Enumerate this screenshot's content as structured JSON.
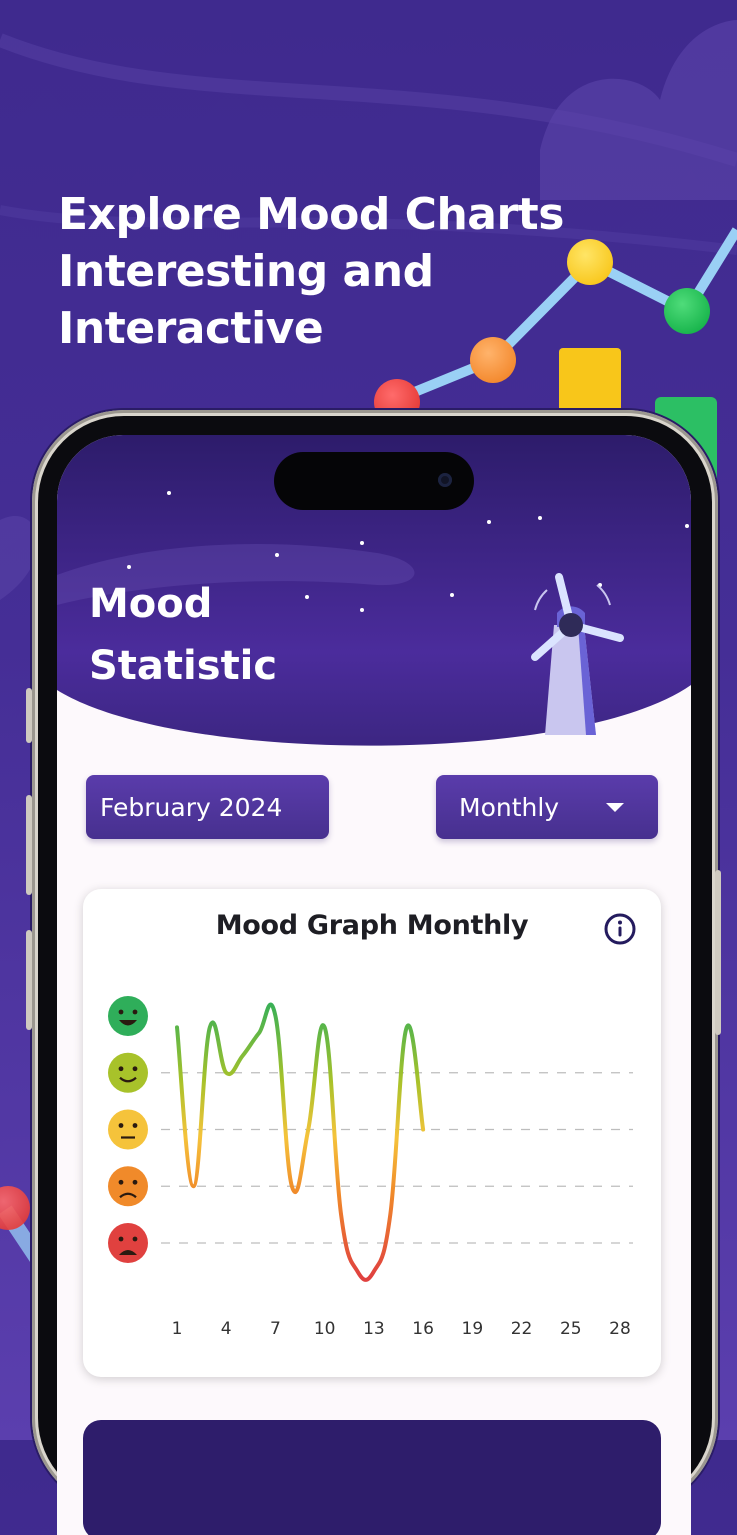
{
  "headline": {
    "lines": [
      "Explore Mood Charts",
      "Interesting and",
      "Interactive"
    ]
  },
  "screen": {
    "title_lines": [
      "Mood",
      "Statistic"
    ],
    "date_selector": {
      "label": "February 2024"
    },
    "period_selector": {
      "label": "Monthly",
      "icon": "caret-down-icon"
    },
    "mood_card": {
      "title": "Mood Graph Monthly",
      "info_icon": "info-icon"
    }
  },
  "colors": {
    "background": "#452e96",
    "accent": "#4f359c",
    "card": "#ffffff",
    "great": "#2fae5a",
    "good": "#a8c22a",
    "neutral": "#f5c33b",
    "bad": "#f08a2a",
    "awful": "#e0413f"
  },
  "chart_data": {
    "type": "line",
    "title": "Mood Graph Monthly",
    "xlabel": "",
    "ylabel": "",
    "mood_levels": [
      "awful",
      "bad",
      "neutral",
      "good",
      "great"
    ],
    "y_scale": "1 = awful, 5 = great",
    "ylim": [
      1,
      5
    ],
    "x_ticks": [
      1,
      4,
      7,
      10,
      13,
      16,
      19,
      22,
      25,
      28
    ],
    "xlim": [
      1,
      28
    ],
    "grid": "dashed horizontal lines at levels 1-4",
    "series": [
      {
        "x": [
          1,
          2,
          3,
          4,
          5,
          6,
          7,
          8,
          9,
          10,
          11,
          12,
          13,
          14,
          15,
          16
        ],
        "values": [
          4.8,
          2,
          4.8,
          4,
          4.3,
          4.7,
          5,
          2,
          3,
          4.8,
          1.5,
          0.5,
          0.5,
          1.5,
          4.8,
          3
        ]
      }
    ]
  }
}
